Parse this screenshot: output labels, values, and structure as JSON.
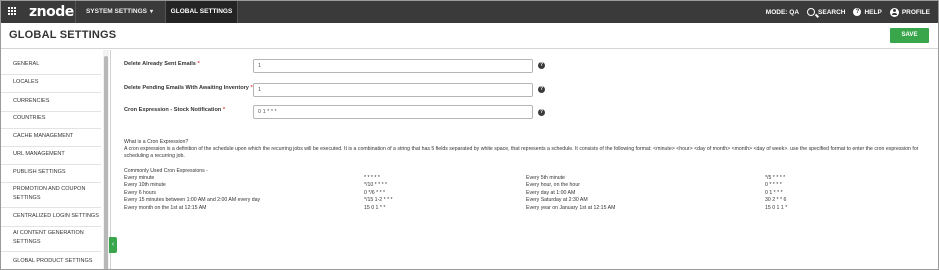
{
  "topbar": {
    "logo": "znode",
    "nav": [
      {
        "label": "SYSTEM SETTINGS"
      },
      {
        "label": "GLOBAL SETTINGS"
      }
    ],
    "mode_label": "MODE: QA",
    "search_label": "SEARCH",
    "help_label": "HELP",
    "profile_label": "PROFILE"
  },
  "header": {
    "title": "GLOBAL SETTINGS",
    "save_label": "SAVE"
  },
  "sidebar": {
    "items": [
      {
        "label": "GENERAL"
      },
      {
        "label": "LOCALES"
      },
      {
        "label": "CURRENCIES"
      },
      {
        "label": "COUNTRIES"
      },
      {
        "label": "CACHE MANAGEMENT"
      },
      {
        "label": "URL MANAGEMENT"
      },
      {
        "label": "PUBLISH SETTINGS"
      },
      {
        "label": "PROMOTION AND COUPON SETTINGS"
      },
      {
        "label": "CENTRALIZED LOGIN SETTINGS"
      },
      {
        "label": "AI CONTENT GENERATION SETTINGS"
      },
      {
        "label": "GLOBAL PRODUCT SETTINGS"
      }
    ]
  },
  "form": {
    "fields": [
      {
        "label": "Delete Already Sent Emails",
        "required": "*",
        "value": "1"
      },
      {
        "label": "Delete Pending Emails With Awaiting Inventory",
        "required": "*",
        "value": "1"
      },
      {
        "label": "Cron Expression - Stock Notification",
        "required": "*",
        "value": "0 1 * * *"
      }
    ]
  },
  "info": {
    "title": "What is a Cron Expression?",
    "body": "A cron expression is a definition of the schedule upon which the recurring jobs will be executed. It is a combination of a string that has 5 fields separated by white space, that represents a schedule. It consists of the following format: <minute> <hour> <day of month> <month> <day of week>. use the specified format to enter the cron expression for scheduling a recurring job.",
    "common_title": "Commonly Used Cron Expressions -",
    "left": [
      {
        "desc": "Every minute",
        "expr": "* * * * *"
      },
      {
        "desc": "Every 10th minute",
        "expr": "*/10 * * * *"
      },
      {
        "desc": "Every 6 hours",
        "expr": "0 */6 * * *"
      },
      {
        "desc": "Every 15 minutes between 1:00 AM and 2:00 AM every day",
        "expr": "*/15 1-2 * * *"
      },
      {
        "desc": "Every month on the 1st at 12:15 AM",
        "expr": "15 0 1 * *"
      }
    ],
    "right": [
      {
        "desc": "Every 5th minute",
        "expr": "*/5 * * * *"
      },
      {
        "desc": "Every hour, on the hour",
        "expr": "0 * * * *"
      },
      {
        "desc": "Every day at 1:00 AM",
        "expr": "0 1 * * *"
      },
      {
        "desc": "Every Saturday at 2:30 AM",
        "expr": "30 2 * * 6"
      },
      {
        "desc": "Every year on January 1st at 12:15 AM",
        "expr": "15 0 1 1 *"
      }
    ]
  }
}
